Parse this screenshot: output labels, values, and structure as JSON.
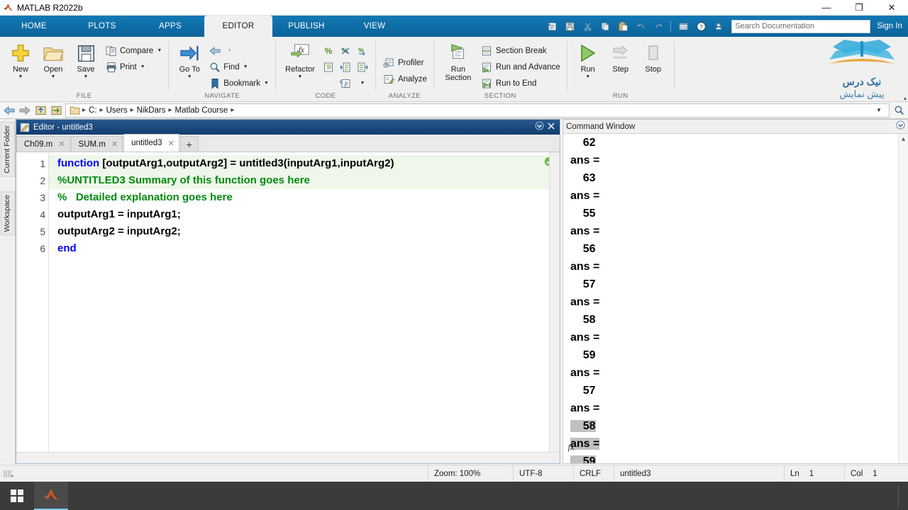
{
  "window": {
    "title": "MATLAB R2022b",
    "app_icon": "matlab-icon",
    "minimize": "—",
    "maximize": "❐",
    "close": "✕"
  },
  "ribbon_tabs": [
    {
      "label": "HOME",
      "active": false
    },
    {
      "label": "PLOTS",
      "active": false
    },
    {
      "label": "APPS",
      "active": false
    },
    {
      "label": "EDITOR",
      "active": true
    },
    {
      "label": "PUBLISH",
      "active": false
    },
    {
      "label": "VIEW",
      "active": false
    }
  ],
  "quick_access": {
    "icons": [
      "new-script-icon",
      "save-icon",
      "cut-icon",
      "copy-icon",
      "paste-icon",
      "undo-icon",
      "redo-icon",
      "layout-icon",
      "help-icon",
      "community-icon"
    ],
    "search": {
      "placeholder": "Search Documentation",
      "value": ""
    },
    "sign_in": "Sign In"
  },
  "ribbon_groups": [
    {
      "name": "FILE",
      "label": "FILE",
      "big_buttons": [
        {
          "label": "New",
          "icon": "new-file-icon",
          "dropdown": true
        },
        {
          "label": "Open",
          "icon": "open-folder-icon",
          "dropdown": true
        },
        {
          "label": "Save",
          "icon": "save-disk-icon",
          "dropdown": true
        }
      ],
      "small_buttons": [
        {
          "label": "Compare",
          "icon": "compare-icon",
          "dropdown": true
        },
        {
          "label": "Print",
          "icon": "print-icon",
          "dropdown": true
        }
      ]
    },
    {
      "name": "NAVIGATE",
      "label": "NAVIGATE",
      "big_buttons": [
        {
          "label": "Go To",
          "icon": "go-to-icon",
          "dropdown": true
        }
      ],
      "small_buttons": [
        {
          "label": "",
          "icon": "back-arrow-icon",
          "dropdown": false
        },
        {
          "label": "Find",
          "icon": "find-icon",
          "dropdown": true
        },
        {
          "label": "Bookmark",
          "icon": "bookmark-icon",
          "dropdown": true
        }
      ]
    },
    {
      "name": "CODE",
      "label": "CODE",
      "big_buttons": [
        {
          "label": "Refactor",
          "icon": "refactor-fx-icon",
          "dropdown": true
        }
      ],
      "mini_icons": [
        "comment-icon",
        "uncomment-icon",
        "wrap-comments-icon",
        "smart-indent-icon",
        "increase-indent-icon",
        "decrease-indent-icon",
        "insert-function-icon"
      ]
    },
    {
      "name": "ANALYZE",
      "label": "ANALYZE",
      "small_buttons": [
        {
          "label": "Profiler",
          "icon": "profiler-icon",
          "dropdown": false
        },
        {
          "label": "Analyze",
          "icon": "analyze-icon",
          "dropdown": false
        }
      ]
    },
    {
      "name": "SECTION",
      "label": "SECTION",
      "big_buttons": [
        {
          "label": "Run\nSection",
          "icon": "run-section-icon",
          "dropdown": false
        }
      ],
      "small_buttons": [
        {
          "label": "Section Break",
          "icon": "section-break-icon",
          "dropdown": false
        },
        {
          "label": "Run and Advance",
          "icon": "run-advance-icon",
          "dropdown": false
        },
        {
          "label": "Run to End",
          "icon": "run-to-end-icon",
          "dropdown": false
        }
      ]
    },
    {
      "name": "RUN",
      "label": "RUN",
      "big_buttons": [
        {
          "label": "Run",
          "icon": "run-play-icon",
          "dropdown": true
        },
        {
          "label": "Step",
          "icon": "step-icon",
          "dropdown": false
        },
        {
          "label": "Stop",
          "icon": "stop-icon",
          "dropdown": false
        }
      ]
    }
  ],
  "brand": {
    "icon": "nikdars-book-logo",
    "line1": "نیک درس",
    "line2": "پیش نمایش",
    "collapse": "▴"
  },
  "address_bar": {
    "back_icon": "back-arrow-icon",
    "forward_icon": "forward-arrow-icon",
    "up_icon": "up-folder-icon",
    "browse_icon": "browse-folder-icon",
    "folder_icon": "folder-icon",
    "path": [
      "C:",
      "Users",
      "NikDars",
      "Matlab Course"
    ],
    "separator": "▸",
    "dropdown_icon": "chevron-down-icon",
    "search_icon": "search-icon"
  },
  "left_rail": [
    {
      "label": "Current Folder"
    },
    {
      "label": "Workspace"
    }
  ],
  "editor": {
    "panel_title": "Editor - untitled3",
    "panel_icon": "editor-icon",
    "dock_icon": "dock-chevron-icon",
    "close_icon": "close-icon",
    "tabs": [
      {
        "label": "Ch09.m",
        "active": false,
        "close": "✕"
      },
      {
        "label": "SUM.m",
        "active": false,
        "close": "✕"
      },
      {
        "label": "untitled3",
        "active": true,
        "close": "✕"
      }
    ],
    "new_tab": "+",
    "status_icon": "code-ok-icon",
    "lines": [
      {
        "num": "1",
        "fold": true,
        "highlight": true,
        "tokens": [
          {
            "t": "function",
            "c": "kw"
          },
          {
            "t": " [outputArg1,outputArg2] = untitled3(inputArg1,inputArg2)",
            "c": "pl"
          }
        ]
      },
      {
        "num": "2",
        "fold": true,
        "highlight": true,
        "tokens": [
          {
            "t": "%UNTITLED3 Summary of this function goes here",
            "c": "cm"
          }
        ]
      },
      {
        "num": "3",
        "fold": false,
        "highlight": false,
        "tokens": [
          {
            "t": "%   Detailed explanation goes here",
            "c": "cm"
          }
        ]
      },
      {
        "num": "4",
        "fold": false,
        "highlight": false,
        "tokens": [
          {
            "t": "outputArg1 = inputArg1;",
            "c": "pl"
          }
        ]
      },
      {
        "num": "5",
        "fold": false,
        "highlight": false,
        "tokens": [
          {
            "t": "outputArg2 = inputArg2;",
            "c": "pl"
          }
        ]
      },
      {
        "num": "6",
        "fold": true,
        "highlight": false,
        "tokens": [
          {
            "t": "end",
            "c": "kw"
          }
        ]
      }
    ]
  },
  "command_window": {
    "title": "Command Window",
    "dock_icon": "dock-chevron-icon",
    "fx_icon": "fx-icon",
    "lines": [
      {
        "text": "    62",
        "selected": false
      },
      {
        "text": "ans =",
        "selected": false
      },
      {
        "text": "    63",
        "selected": false
      },
      {
        "text": "ans =",
        "selected": false
      },
      {
        "text": "    55",
        "selected": false
      },
      {
        "text": "ans =",
        "selected": false
      },
      {
        "text": "    56",
        "selected": false
      },
      {
        "text": "ans =",
        "selected": false
      },
      {
        "text": "    57",
        "selected": false
      },
      {
        "text": "ans =",
        "selected": false
      },
      {
        "text": "    58",
        "selected": false
      },
      {
        "text": "ans =",
        "selected": false
      },
      {
        "text": "    59",
        "selected": false
      },
      {
        "text": "ans =",
        "selected": false
      },
      {
        "text": "    57",
        "selected": false
      },
      {
        "text": "ans =",
        "selected": false
      },
      {
        "text": "    58",
        "selected": true
      },
      {
        "text": "ans =",
        "selected": true
      },
      {
        "text": "    59",
        "selected": true
      }
    ]
  },
  "status_bar": {
    "zoom": "Zoom: 100%",
    "encoding": "UTF-8",
    "line_ending": "CRLF",
    "file": "untitled3",
    "ln_label": "Ln",
    "ln_value": "1",
    "col_label": "Col",
    "col_value": "1"
  },
  "taskbar": {
    "start_icon": "windows-start-icon",
    "apps": [
      {
        "icon": "matlab-taskbar-icon",
        "active": true
      }
    ],
    "tray_icon": "show-desktop-icon"
  },
  "colors": {
    "ribbon_blue": "#0a6299",
    "panel_title_blue": "#1d4e89",
    "keyword": "#0000ff",
    "comment": "#028a0f",
    "selection": "#c0c0c0",
    "taskbar": "#3b3b3b"
  }
}
